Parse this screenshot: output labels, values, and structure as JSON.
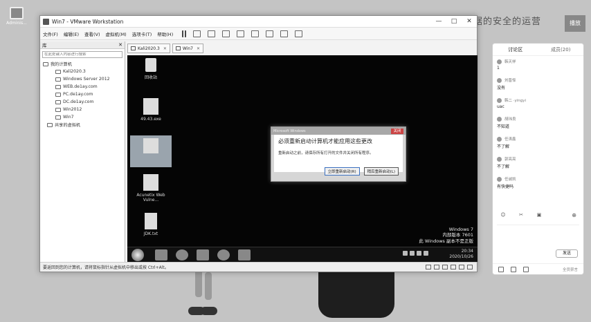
{
  "desktop": {
    "icon_label": "Adminis..."
  },
  "vmware": {
    "title": "Win7 - VMware Workstation",
    "window_controls": [
      "—",
      "□",
      "✕"
    ],
    "menu": [
      "文件(F)",
      "编辑(E)",
      "查看(V)",
      "虚拟机(M)",
      "选项卡(T)",
      "帮助(H)"
    ],
    "library": {
      "title": "库",
      "close": "✕",
      "search_placeholder": "在此处键入内容进行搜索",
      "root": "我的计算机",
      "vms": [
        "Kali2020.3",
        "Windows Server 2012",
        "WEB.de1ay.com",
        "PC.de1ay.com",
        "DC.de1ay.com",
        "Win2012",
        "Win7"
      ],
      "shared": "共享的虚拟机"
    },
    "tabs": [
      {
        "label": "Kali2020.3",
        "close": "✕"
      },
      {
        "label": "Win7",
        "close": "✕"
      }
    ],
    "status_text": "要返回到您的计算机，请将鼠标指针从虚拟机中移出或按 Ctrl+Alt。"
  },
  "guest": {
    "icons": [
      {
        "label": "回收站"
      },
      {
        "label": "49.43.exe"
      },
      {
        "label": ""
      },
      {
        "label": "Acunetix Web Vulne..."
      },
      {
        "label": "JDK.txt"
      }
    ],
    "dialog": {
      "titlebar": "Microsoft Windows",
      "close": "关闭",
      "heading": "必须重新启动计算机才能应用这些更改",
      "message": "重新启动之前，请保存所有打开的文件并关闭所有程序。",
      "restart_now": "立即重新启动(R)",
      "restart_later": "稍后重新启动(L)"
    },
    "watermark": {
      "line1": "Windows 7",
      "line2": "内部版本 7601",
      "line3": "此 Windows 副本不是正版"
    },
    "clock": {
      "time": "20:34",
      "date": "2020/10/26"
    }
  },
  "live": {
    "title": "数据的安全的运营",
    "chip": "播放"
  },
  "discussion": {
    "tab_discuss": "讨论区",
    "tab_members": "成员(20)",
    "messages": [
      {
        "name": "韩天祥",
        "text": "1"
      },
      {
        "name": "刘晋怿",
        "text": "没有"
      },
      {
        "name": "韩二 ·yingyi",
        "text": "uac"
      },
      {
        "name": "胡玮良",
        "text": "不知道"
      },
      {
        "name": "任涛鑫",
        "text": "不了解"
      },
      {
        "name": "郭亮亮",
        "text": "不了解"
      },
      {
        "name": "任诚凯",
        "text": "有快捷吗"
      }
    ],
    "tools": [
      "☺",
      "✂",
      "▣"
    ],
    "add": "⊕",
    "send": "发送",
    "hint": "全员禁言"
  },
  "colors": {
    "guest_bg": "#050505",
    "window_bg": "#f3f3f3"
  }
}
